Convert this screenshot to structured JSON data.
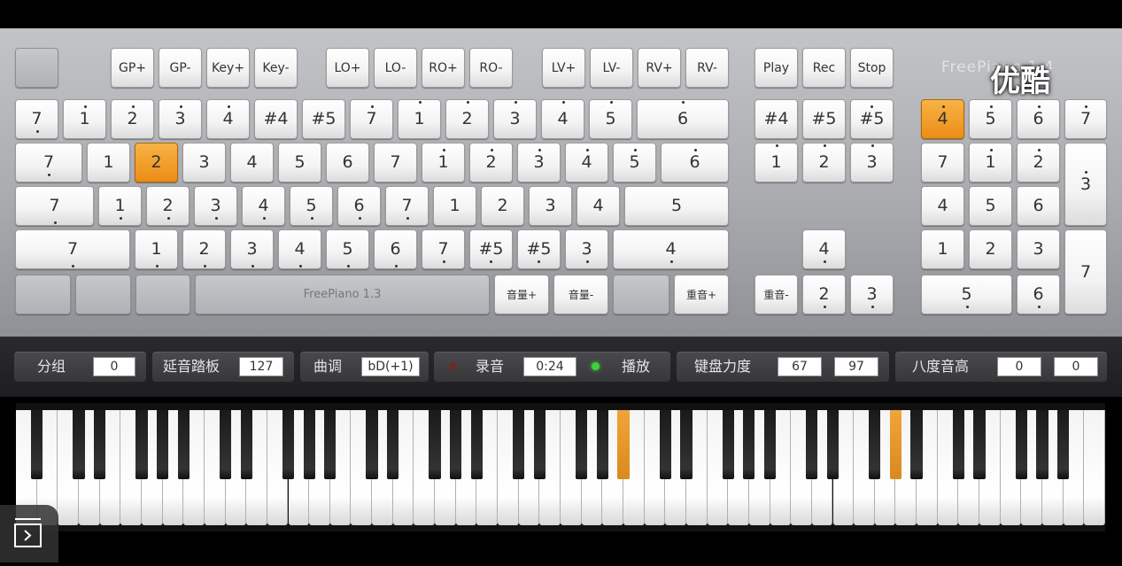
{
  "brand": "FreePiano 1.4",
  "watermark": "优酷",
  "colors": {
    "accent": "#ec8d16",
    "panel": "#b4b5b8",
    "control_bar": "#252527",
    "led_red": "#b33a2a",
    "led_green": "#3dd13d"
  },
  "function_keys": {
    "blank": "",
    "gp_plus": "GP+",
    "gp_minus": "GP-",
    "key_plus": "Key+",
    "key_minus": "Key-",
    "lo_plus": "LO+",
    "lo_minus": "LO-",
    "ro_plus": "RO+",
    "ro_minus": "RO-",
    "lv_plus": "LV+",
    "lv_minus": "LV-",
    "rv_plus": "RV+",
    "rv_minus": "RV-",
    "play": "Play",
    "rec": "Rec",
    "stop": "Stop"
  },
  "main_keys": {
    "row1": [
      "7",
      "1",
      "2",
      "3",
      "4",
      "#4",
      "#5",
      "7",
      "1",
      "2",
      "3",
      "4",
      "5",
      "6"
    ],
    "row2": [
      "7",
      "1",
      "2",
      "3",
      "4",
      "5",
      "6",
      "7",
      "1",
      "2",
      "3",
      "4",
      "5",
      "6"
    ],
    "row3": [
      "7",
      "1",
      "2",
      "3",
      "4",
      "5",
      "6",
      "7",
      "1",
      "2",
      "3",
      "4",
      "5"
    ],
    "row4": [
      "7",
      "1",
      "2",
      "3",
      "4",
      "5",
      "6",
      "7",
      "#5",
      "#5",
      "3",
      "4"
    ],
    "row5": {
      "space": "FreePiano 1.3",
      "vol_up": "音量+",
      "vol_down": "音量-",
      "repeat_up": "重音+"
    }
  },
  "nav_keys": {
    "row1": [
      "#4",
      "#5",
      "#5"
    ],
    "row2": [
      "1",
      "2",
      "3"
    ],
    "up": "4",
    "bottom": {
      "repeat_down": "重音-",
      "down": "2",
      "right": "3"
    }
  },
  "numpad": {
    "row1": [
      "4",
      "5",
      "6",
      "7"
    ],
    "row2": [
      "7",
      "1",
      "2"
    ],
    "plus": "3",
    "row3": [
      "4",
      "5",
      "6"
    ],
    "row4": [
      "1",
      "2",
      "3"
    ],
    "enter": "7",
    "zero": "5",
    "dot": "6"
  },
  "controls": {
    "group": {
      "label": "分组",
      "value": "0"
    },
    "sustain": {
      "label": "延音踏板",
      "value": "127"
    },
    "key": {
      "label": "曲调",
      "value": "bD(+1)"
    },
    "record": {
      "label": "录音",
      "time": "0:24"
    },
    "play": {
      "label": "播放"
    },
    "velocity": {
      "label": "键盘力度",
      "left": "67",
      "right": "97"
    },
    "octave": {
      "label": "八度音高",
      "left": "0",
      "right": "0"
    }
  },
  "piano": {
    "white_key_count": 52,
    "active_black_keys": [
      20,
      29
    ]
  }
}
